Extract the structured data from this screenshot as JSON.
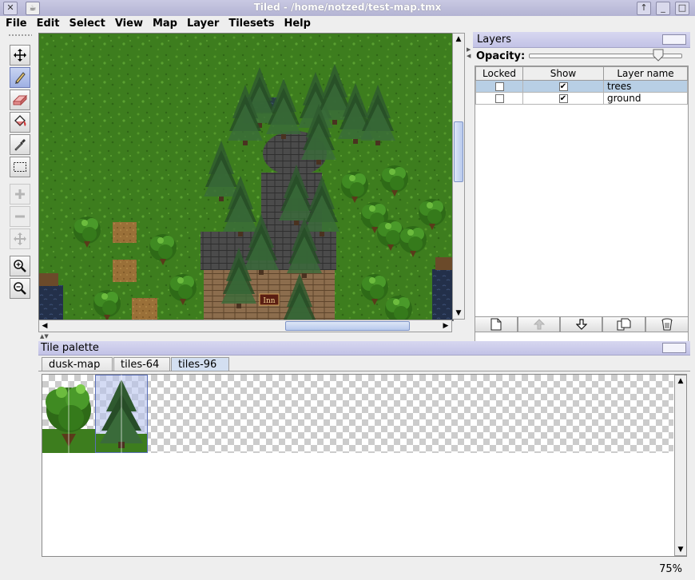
{
  "window": {
    "title": "Tiled - /home/notzed/test-map.tmx",
    "close_glyph": "✕",
    "maximize_glyph": "□",
    "shade_glyph": "↑"
  },
  "menubar": [
    "File",
    "Edit",
    "Select",
    "View",
    "Map",
    "Layer",
    "Tilesets",
    "Help"
  ],
  "toolbar": {
    "tools": [
      {
        "name": "move-tool",
        "icon": "move-arrows-icon",
        "enabled": true,
        "active": false
      },
      {
        "name": "pencil-tool",
        "icon": "pencil-icon",
        "enabled": true,
        "active": true
      },
      {
        "name": "eraser-tool",
        "icon": "eraser-icon",
        "enabled": true,
        "active": false
      },
      {
        "name": "fill-tool",
        "icon": "paint-bucket-icon",
        "enabled": true,
        "active": false
      },
      {
        "name": "eyedropper-tool",
        "icon": "eyedropper-icon",
        "enabled": true,
        "active": false
      },
      {
        "name": "select-tool",
        "icon": "marquee-icon",
        "enabled": true,
        "active": false
      },
      {
        "name": "add-object-tool",
        "icon": "plus-icon",
        "enabled": false,
        "active": false
      },
      {
        "name": "remove-object-tool",
        "icon": "minus-icon",
        "enabled": false,
        "active": false
      },
      {
        "name": "move-object-tool",
        "icon": "move-object-icon",
        "enabled": false,
        "active": false
      },
      {
        "name": "zoom-in-tool",
        "icon": "zoom-in-icon",
        "enabled": true,
        "active": false
      },
      {
        "name": "zoom-out-tool",
        "icon": "zoom-out-icon",
        "enabled": true,
        "active": false
      }
    ]
  },
  "map": {
    "inn_sign": "Inn"
  },
  "layers_panel": {
    "title": "Layers",
    "opacity_label": "Opacity:",
    "opacity_value": 0.85,
    "columns": [
      "Locked",
      "Show",
      "Layer name"
    ],
    "rows": [
      {
        "locked": false,
        "show": true,
        "name": "trees",
        "selected": true
      },
      {
        "locked": false,
        "show": true,
        "name": "ground",
        "selected": false
      }
    ],
    "check_glyph": "✔",
    "buttons": [
      {
        "name": "new-layer-button",
        "icon": "new-page-icon",
        "enabled": true
      },
      {
        "name": "move-layer-up-button",
        "icon": "arrow-up-icon",
        "enabled": false
      },
      {
        "name": "move-layer-down-button",
        "icon": "arrow-down-icon",
        "enabled": true
      },
      {
        "name": "duplicate-layer-button",
        "icon": "duplicate-icon",
        "enabled": true
      },
      {
        "name": "delete-layer-button",
        "icon": "trash-can-icon",
        "enabled": true
      }
    ]
  },
  "tile_palette": {
    "title": "Tile palette",
    "tabs": [
      {
        "label": "dusk-map",
        "selected": false
      },
      {
        "label": "tiles-64",
        "selected": false
      },
      {
        "label": "tiles-96",
        "selected": true
      }
    ]
  },
  "status": {
    "zoom": "75%"
  },
  "colors": {
    "grass": "#3f7f1f",
    "selection_blue": "#b8cfe5",
    "titlebar": "#b8b8d8"
  }
}
